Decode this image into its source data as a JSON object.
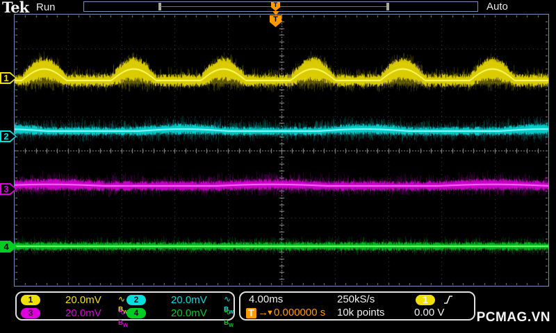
{
  "header": {
    "logo": "Tek",
    "acq_state": "Run",
    "trigger_mode": "Auto"
  },
  "record_view": {
    "trigger_marker": "T"
  },
  "trigger_indicator": "T",
  "icons": {
    "coupling": "∿",
    "bw_b": "B",
    "bw_w": "W"
  },
  "status": {
    "channels": [
      {
        "num": "1",
        "scale": "20.0mV",
        "color": "#f0e000"
      },
      {
        "num": "2",
        "scale": "20.0mV",
        "color": "#00dede"
      },
      {
        "num": "3",
        "scale": "20.0mV",
        "color": "#dd00dd"
      },
      {
        "num": "4",
        "scale": "20.0mV",
        "color": "#00cc22"
      }
    ],
    "timebase": {
      "scale": "4.00ms",
      "sample_rate": "250kS/s",
      "record_length": "10k points"
    },
    "trigger": {
      "source": "1",
      "source_color": "#f0e000",
      "slope": "rising",
      "marker": "T",
      "arrow": "→",
      "pointer": "▼",
      "position": "0.000000 s",
      "level": "0.00 V"
    }
  },
  "watermark": "PCMAG.VN",
  "chart_data": {
    "type": "line",
    "title": "Tektronix oscilloscope, Run / Auto, 4 noisy channels",
    "x_axis": {
      "divisions": 10,
      "seconds_per_division": "4.00ms"
    },
    "y_axis": {
      "divisions": 8,
      "volts_per_division": "20.0mV all channels"
    },
    "grid": {
      "style": "dotted",
      "cols": 10,
      "rows": 8,
      "minor_per_division": 5
    },
    "channels": [
      {
        "name": "CH1",
        "color": "#f0e000",
        "bright": "#ffff70",
        "scale": "20.0mV",
        "position_div_from_top": 1.95,
        "description": "noise band ~0.5 div p-p with rectified-sine hum humps ~0.45 div high, period ~1.7 div",
        "render": {
          "center": 95,
          "coreHalf": 9,
          "haloHalf": 15,
          "humpAmp": 22,
          "humpPeriod": 129,
          "humpPhase": -0.475
        }
      },
      {
        "name": "CH2",
        "color": "#00dede",
        "bright": "#90ffff",
        "scale": "20.0mV",
        "position_div_from_top": 3.5,
        "description": "flat noise band ~0.55 div p-p, slight wobble",
        "render": {
          "center": 168,
          "coreHalf": 6,
          "haloHalf": 14,
          "humpAmp": 4,
          "humpPeriod": 260,
          "humpPhase": 2.0
        }
      },
      {
        "name": "CH3",
        "color": "#dd00dd",
        "bright": "#ff70ff",
        "scale": "20.0mV",
        "position_div_from_top": 5.1,
        "description": "flat noise band ~0.55 div p-p",
        "render": {
          "center": 247,
          "coreHalf": 7,
          "haloHalf": 14,
          "humpAmp": 3,
          "humpPeriod": 320,
          "humpPhase": 0.6
        }
      },
      {
        "name": "CH4",
        "color": "#00cc22",
        "bright": "#70ff70",
        "scale": "20.0mV",
        "position_div_from_top": 6.85,
        "description": "flat noise band ~0.45 div p-p",
        "render": {
          "center": 334,
          "coreHalf": 6,
          "haloHalf": 11,
          "humpAmp": 0,
          "humpPeriod": 200,
          "humpPhase": 0
        }
      }
    ]
  }
}
